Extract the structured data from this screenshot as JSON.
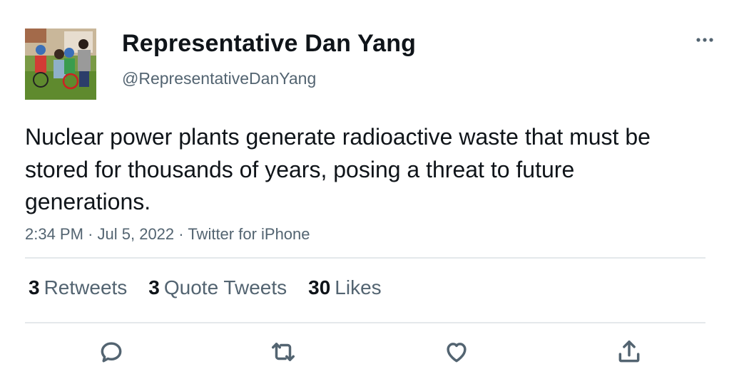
{
  "user": {
    "display_name": "Representative Dan Yang",
    "handle": "@RepresentativeDanYang"
  },
  "tweet": {
    "text": "Nuclear power plants generate radioactive waste that must be stored for thousands of years, posing a threat to future generations.",
    "time": "2:34 PM",
    "date": "Jul 5, 2022",
    "source": "Twitter for iPhone",
    "separator": "·"
  },
  "stats": {
    "retweets_count": "3",
    "retweets_label": "Retweets",
    "quotes_count": "3",
    "quotes_label": "Quote Tweets",
    "likes_count": "30",
    "likes_label": "Likes"
  },
  "icons": {
    "more": "more-icon",
    "reply": "reply-icon",
    "retweet": "retweet-icon",
    "like": "heart-icon",
    "share": "share-icon"
  },
  "colors": {
    "text_primary": "#0f1419",
    "text_secondary": "#536471",
    "divider": "#e4e8eb"
  }
}
